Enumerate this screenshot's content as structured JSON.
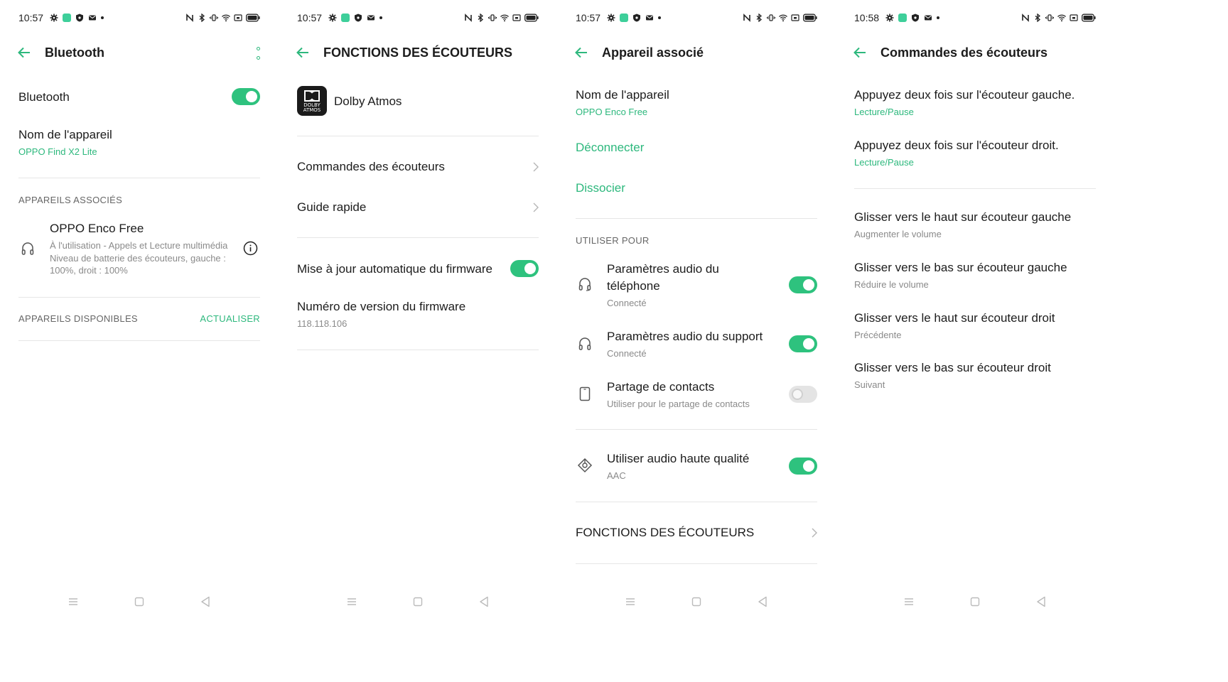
{
  "status_bars": [
    {
      "time": "10:57"
    },
    {
      "time": "10:57"
    },
    {
      "time": "10:57"
    },
    {
      "time": "10:58"
    }
  ],
  "screen1": {
    "title": "Bluetooth",
    "bluetooth_label": "Bluetooth",
    "bluetooth_on": true,
    "device_name_label": "Nom de l'appareil",
    "device_name_value": "OPPO Find X2 Lite",
    "paired_section": "APPAREILS ASSOCIÉS",
    "paired_device": {
      "name": "OPPO Enco Free",
      "line1": "À l'utilisation - Appels et Lecture multimédia",
      "line2": "Niveau de batterie des écouteurs, gauche :",
      "line3": "100%, droit : 100%"
    },
    "available_section": "APPAREILS DISPONIBLES",
    "refresh_label": "ACTUALISER"
  },
  "screen2": {
    "title": "FONCTIONS DES ÉCOUTEURS",
    "dolby_label": "Dolby Atmos",
    "dolby_logo_line1": "DOLBY",
    "dolby_logo_line2": "ATMOS",
    "controls_label": "Commandes des écouteurs",
    "guide_label": "Guide rapide",
    "auto_update_label": "Mise à jour automatique du firmware",
    "auto_update_on": true,
    "firmware_label": "Numéro de version du firmware",
    "firmware_value": "118.118.106"
  },
  "screen3": {
    "title": "Appareil associé",
    "device_name_label": "Nom de l'appareil",
    "device_name_value": "OPPO Enco Free",
    "disconnect_label": "Déconnecter",
    "unpair_label": "Dissocier",
    "use_for_section": "UTILISER POUR",
    "phone_audio_line1": "Paramètres audio du",
    "phone_audio_line2": "téléphone",
    "phone_audio_status": "Connecté",
    "phone_audio_on": true,
    "media_audio_label": "Paramètres audio du support",
    "media_audio_status": "Connecté",
    "media_audio_on": true,
    "contacts_label": "Partage de contacts",
    "contacts_desc": "Utiliser pour le partage de contacts",
    "contacts_on": false,
    "hq_audio_label": "Utiliser audio haute qualité",
    "hq_audio_codec": "AAC",
    "hq_audio_on": true,
    "functions_label": "FONCTIONS DES ÉCOUTEURS"
  },
  "screen4": {
    "title": "Commandes des écouteurs",
    "items": [
      {
        "label": "Appuyez deux fois sur l'écouteur gauche.",
        "value": "Lecture/Pause"
      },
      {
        "label": "Appuyez deux fois sur l'écouteur droit.",
        "value": "Lecture/Pause"
      },
      {
        "label": "Glisser vers le haut sur écouteur gauche",
        "value": "Augmenter le volume"
      },
      {
        "label": "Glisser vers le bas sur écouteur gauche",
        "value": "Réduire le volume"
      },
      {
        "label": "Glisser vers le haut sur écouteur droit",
        "value": "Précédente"
      },
      {
        "label": "Glisser vers le bas sur écouteur droit",
        "value": "Suivant"
      }
    ]
  },
  "colors": {
    "accent": "#2db87d",
    "toggle_on": "#2ec27e",
    "divider": "#e6e6e6"
  }
}
